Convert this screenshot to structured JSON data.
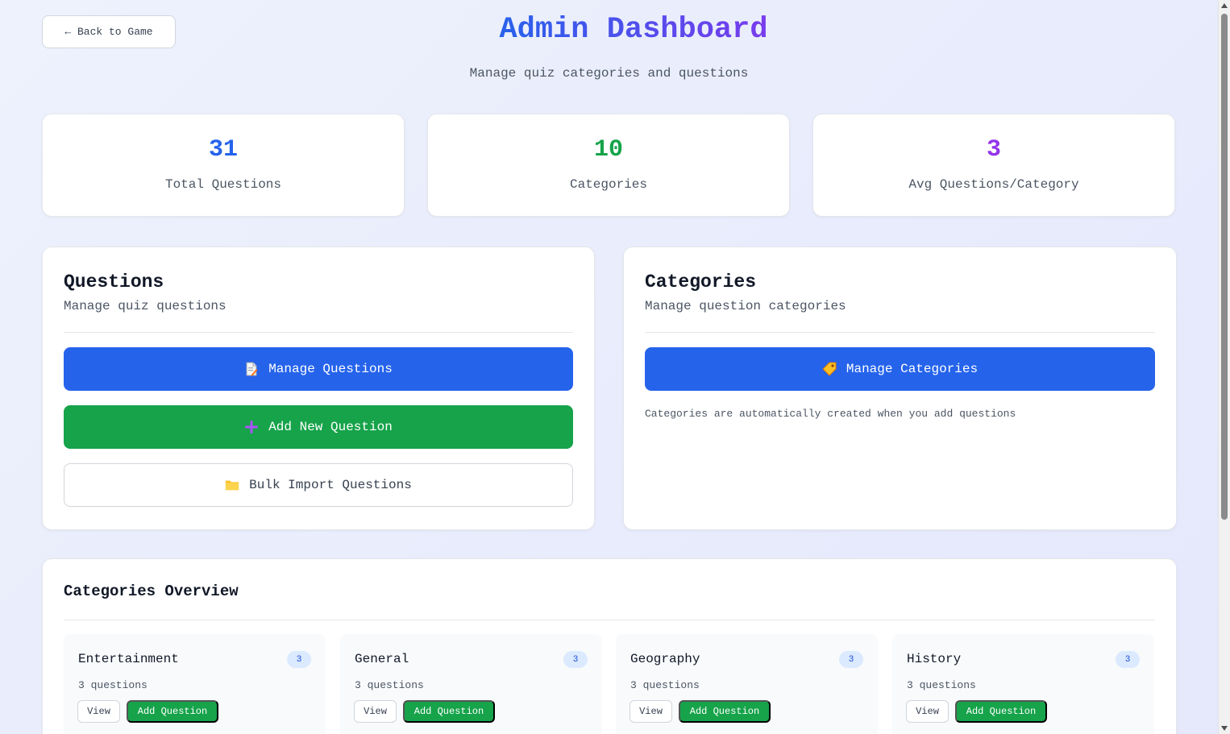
{
  "header": {
    "back_label": "← Back to Game",
    "title": "Admin Dashboard",
    "subtitle": "Manage quiz categories and questions"
  },
  "stats": [
    {
      "value": "31",
      "label": "Total Questions",
      "color": "#2563eb"
    },
    {
      "value": "10",
      "label": "Categories",
      "color": "#16a34a"
    },
    {
      "value": "3",
      "label": "Avg Questions/Category",
      "color": "#9333ea"
    }
  ],
  "questions_panel": {
    "title": "Questions",
    "description": "Manage quiz questions",
    "manage_label": "Manage Questions",
    "manage_icon": "memo-icon",
    "add_label": "Add New Question",
    "add_icon": "plus-icon",
    "import_label": "Bulk Import Questions",
    "import_icon": "folder-icon"
  },
  "categories_panel": {
    "title": "Categories",
    "description": "Manage question categories",
    "manage_label": "Manage Categories",
    "manage_icon": "tag-icon",
    "hint": "Categories are automatically created when you add questions"
  },
  "overview": {
    "title": "Categories Overview",
    "cards": [
      {
        "name": "Entertainment",
        "badge": "3",
        "count": "3 questions",
        "view_label": "View",
        "add_label": "Add Question"
      },
      {
        "name": "General",
        "badge": "3",
        "count": "3 questions",
        "view_label": "View",
        "add_label": "Add Question"
      },
      {
        "name": "Geography",
        "badge": "3",
        "count": "3 questions",
        "view_label": "View",
        "add_label": "Add Question"
      },
      {
        "name": "History",
        "badge": "3",
        "count": "3 questions",
        "view_label": "View",
        "add_label": "Add Question"
      }
    ]
  },
  "theme": {
    "primary": "#2563eb",
    "success": "#16a34a",
    "accent_purple": "#9333ea"
  }
}
